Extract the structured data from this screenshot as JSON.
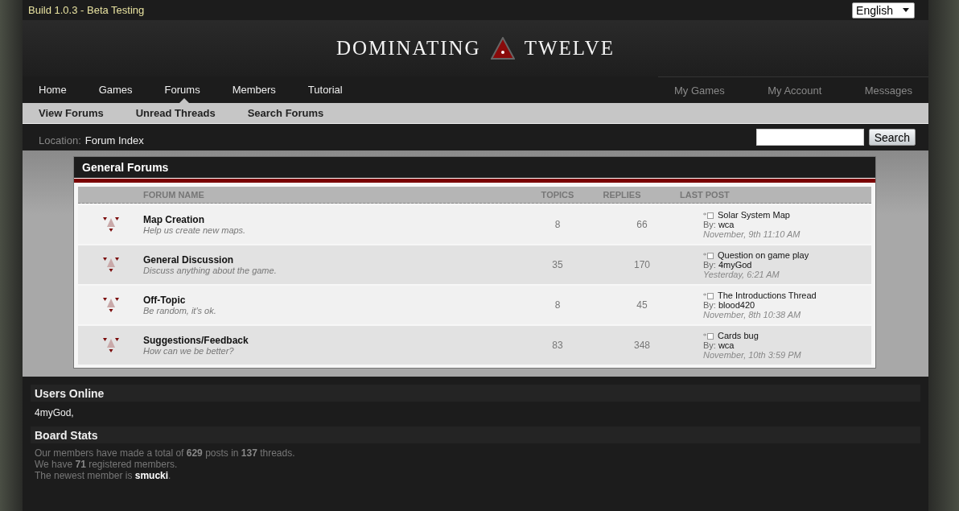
{
  "top_bar": {
    "build": "Build 1.0.3 - Beta Testing",
    "language": "English"
  },
  "logo": {
    "left": "DOMINATING",
    "right": "TWELVE"
  },
  "nav": [
    {
      "label": "Home",
      "selected": false
    },
    {
      "label": "Games",
      "selected": false
    },
    {
      "label": "Forums",
      "selected": true
    },
    {
      "label": "Members",
      "selected": false
    },
    {
      "label": "Tutorial",
      "selected": false
    }
  ],
  "account_nav": [
    "My Games",
    "My Account",
    "Messages"
  ],
  "sub_nav": [
    "View Forums",
    "Unread Threads",
    "Search Forums"
  ],
  "location": {
    "label": "Location:",
    "value": "Forum Index"
  },
  "search": {
    "button": "Search"
  },
  "forum_section": {
    "title": "General Forums",
    "columns": [
      "FORUM NAME",
      "TOPICS",
      "REPLIES",
      "LAST POST"
    ],
    "rows": [
      {
        "name": "Map Creation",
        "description": "Help us create new maps.",
        "topics": "8",
        "replies": "66",
        "last_title": "Solar System Map",
        "by_label": "By:",
        "last_author": "wca",
        "last_time": "November, 9th 11:10 AM"
      },
      {
        "name": "General Discussion",
        "description": "Discuss anything about the game.",
        "topics": "35",
        "replies": "170",
        "last_title": "Question on game play",
        "by_label": "By:",
        "last_author": "4myGod",
        "last_time": "Yesterday, 6:21 AM"
      },
      {
        "name": "Off-Topic",
        "description": "Be random, it's ok.",
        "topics": "8",
        "replies": "45",
        "last_title": "The Introductions Thread",
        "by_label": "By:",
        "last_author": "blood420",
        "last_time": "November, 8th 10:38 AM"
      },
      {
        "name": "Suggestions/Feedback",
        "description": "How can we be better?",
        "topics": "83",
        "replies": "348",
        "last_title": "Cards bug",
        "by_label": "By:",
        "last_author": "wca",
        "last_time": "November, 10th 3:59 PM"
      }
    ]
  },
  "users_online": {
    "title": "Users Online",
    "users": "4myGod,"
  },
  "board_stats": {
    "title": "Board Stats",
    "lines": [
      "Our members have made a total of **629** posts in **137** threads.",
      "We have **71** registered members.",
      "The newest member is **smucki**."
    ]
  }
}
